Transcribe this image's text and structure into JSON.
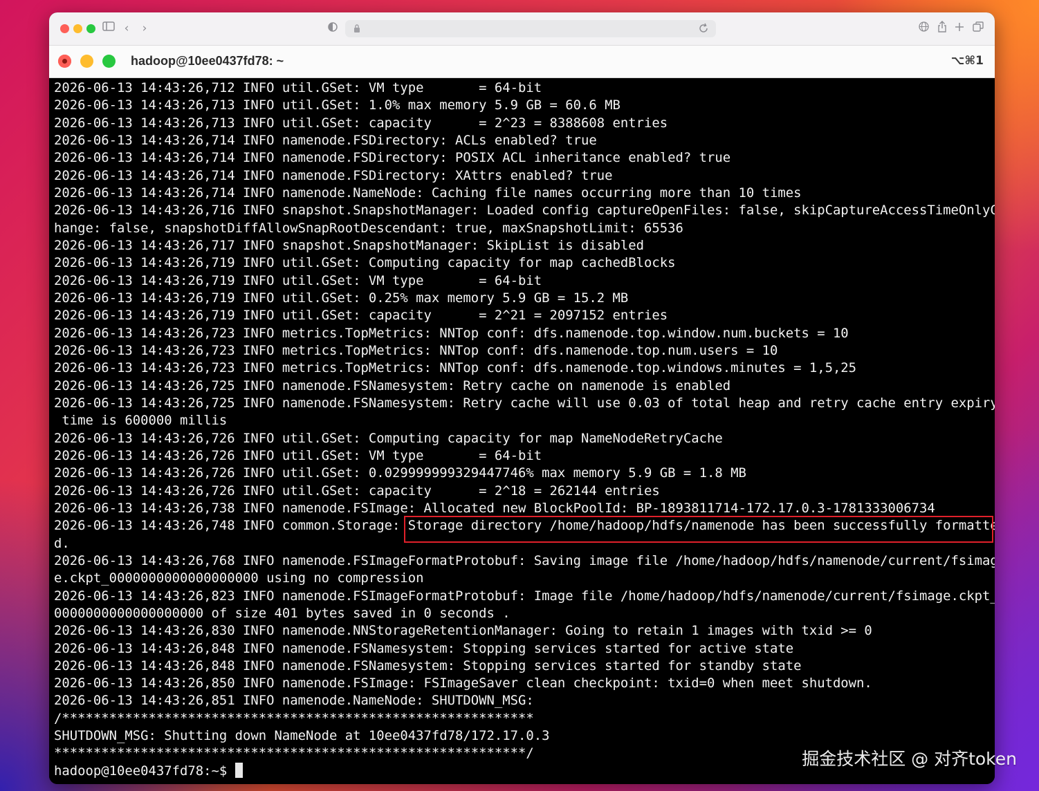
{
  "browser": {
    "nav_back": "‹",
    "nav_forward": "›",
    "sidebar_icon": "sidebar-icon",
    "lock_icon": "lock-icon",
    "reload_icon": "reload-icon",
    "privacy_icon": "shield-half-icon",
    "toolbar_right_icons": [
      "globe-icon",
      "share-icon",
      "plus-icon",
      "tabs-icon"
    ]
  },
  "terminal": {
    "title": "hadoop@10ee0437fd78: ~",
    "shortcut": "⌥⌘1",
    "lines": [
      "2026-06-13 14:43:26,712 INFO util.GSet: VM type       = 64-bit",
      "2026-06-13 14:43:26,713 INFO util.GSet: 1.0% max memory 5.9 GB = 60.6 MB",
      "2026-06-13 14:43:26,713 INFO util.GSet: capacity      = 2^23 = 8388608 entries",
      "2026-06-13 14:43:26,714 INFO namenode.FSDirectory: ACLs enabled? true",
      "2026-06-13 14:43:26,714 INFO namenode.FSDirectory: POSIX ACL inheritance enabled? true",
      "2026-06-13 14:43:26,714 INFO namenode.FSDirectory: XAttrs enabled? true",
      "2026-06-13 14:43:26,714 INFO namenode.NameNode: Caching file names occurring more than 10 times",
      "2026-06-13 14:43:26,716 INFO snapshot.SnapshotManager: Loaded config captureOpenFiles: false, skipCaptureAccessTimeOnlyC",
      "hange: false, snapshotDiffAllowSnapRootDescendant: true, maxSnapshotLimit: 65536",
      "2026-06-13 14:43:26,717 INFO snapshot.SnapshotManager: SkipList is disabled",
      "2026-06-13 14:43:26,719 INFO util.GSet: Computing capacity for map cachedBlocks",
      "2026-06-13 14:43:26,719 INFO util.GSet: VM type       = 64-bit",
      "2026-06-13 14:43:26,719 INFO util.GSet: 0.25% max memory 5.9 GB = 15.2 MB",
      "2026-06-13 14:43:26,719 INFO util.GSet: capacity      = 2^21 = 2097152 entries",
      "2026-06-13 14:43:26,723 INFO metrics.TopMetrics: NNTop conf: dfs.namenode.top.window.num.buckets = 10",
      "2026-06-13 14:43:26,723 INFO metrics.TopMetrics: NNTop conf: dfs.namenode.top.num.users = 10",
      "2026-06-13 14:43:26,723 INFO metrics.TopMetrics: NNTop conf: dfs.namenode.top.windows.minutes = 1,5,25",
      "2026-06-13 14:43:26,725 INFO namenode.FSNamesystem: Retry cache on namenode is enabled",
      "2026-06-13 14:43:26,725 INFO namenode.FSNamesystem: Retry cache will use 0.03 of total heap and retry cache entry expiry",
      " time is 600000 millis",
      "2026-06-13 14:43:26,726 INFO util.GSet: Computing capacity for map NameNodeRetryCache",
      "2026-06-13 14:43:26,726 INFO util.GSet: VM type       = 64-bit",
      "2026-06-13 14:43:26,726 INFO util.GSet: 0.029999999329447746% max memory 5.9 GB = 1.8 MB",
      "2026-06-13 14:43:26,726 INFO util.GSet: capacity      = 2^18 = 262144 entries",
      "2026-06-13 14:43:26,738 INFO namenode.FSImage: Allocated new BlockPoolId: BP-1893811714-172.17.0.3-1781333006734",
      "2026-06-13 14:43:26,748 INFO common.Storage: Storage directory /home/hadoop/hdfs/namenode has been successfully formatte",
      "d.",
      "2026-06-13 14:43:26,768 INFO namenode.FSImageFormatProtobuf: Saving image file /home/hadoop/hdfs/namenode/current/fsimag",
      "e.ckpt_0000000000000000000 using no compression",
      "2026-06-13 14:43:26,823 INFO namenode.FSImageFormatProtobuf: Image file /home/hadoop/hdfs/namenode/current/fsimage.ckpt_",
      "0000000000000000000 of size 401 bytes saved in 0 seconds .",
      "2026-06-13 14:43:26,830 INFO namenode.NNStorageRetentionManager: Going to retain 1 images with txid >= 0",
      "2026-06-13 14:43:26,848 INFO namenode.FSNamesystem: Stopping services started for active state",
      "2026-06-13 14:43:26,848 INFO namenode.FSNamesystem: Stopping services started for standby state",
      "2026-06-13 14:43:26,850 INFO namenode.FSImage: FSImageSaver clean checkpoint: txid=0 when meet shutdown.",
      "2026-06-13 14:43:26,851 INFO namenode.NameNode: SHUTDOWN_MSG:",
      "/************************************************************",
      "SHUTDOWN_MSG: Shutting down NameNode at 10ee0437fd78/172.17.0.3",
      "************************************************************/"
    ],
    "prompt": "hadoop@10ee0437fd78:~$ "
  },
  "annotation": {
    "highlight_color": "#e0202a"
  },
  "watermark": {
    "text": "掘金技术社区 @ 对齐token"
  }
}
